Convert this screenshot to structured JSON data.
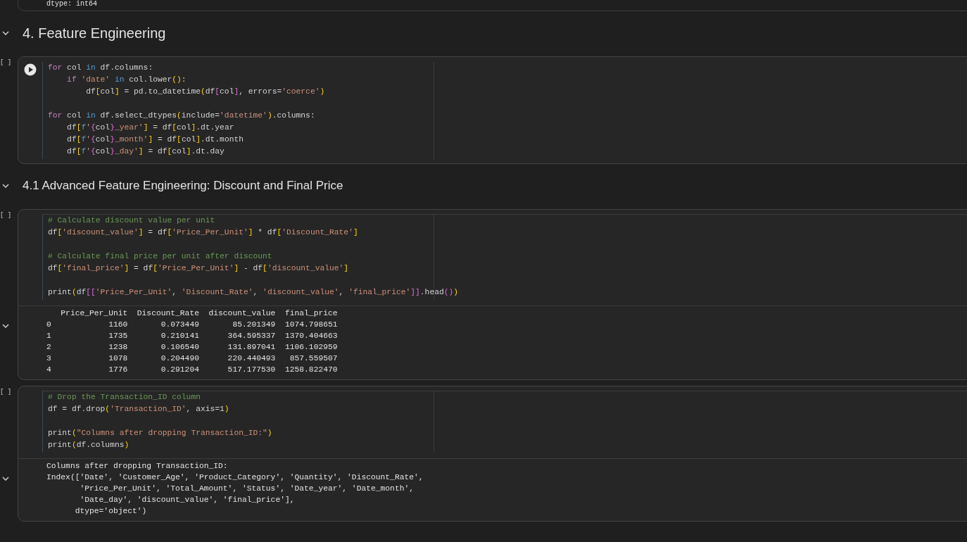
{
  "top_output": {
    "lines": [
      "dtype: int64"
    ]
  },
  "cells": [
    {
      "kind": "heading",
      "text": "4. Feature Engineering",
      "expanded": true
    },
    {
      "kind": "code",
      "counter": "[ ]",
      "run_button": true,
      "lines": [
        {
          "kind": "code",
          "tokens": [
            {
              "kind": "kw",
              "text": "for"
            },
            {
              "kind": "p",
              "text": " col "
            },
            {
              "kind": "op",
              "text": "in"
            },
            {
              "kind": "p",
              "text": " df.columns:"
            }
          ]
        },
        {
          "kind": "code",
          "tokens": [
            {
              "kind": "kw",
              "text": "    if"
            },
            {
              "kind": "str",
              "text": " 'date'"
            },
            {
              "kind": "op",
              "text": " in"
            },
            {
              "kind": "p",
              "text": " col.lower"
            },
            {
              "kind": "b1",
              "text": "()"
            },
            {
              "kind": "p",
              "text": ":"
            }
          ]
        },
        {
          "kind": "code",
          "tokens": [
            {
              "kind": "p",
              "text": "        df"
            },
            {
              "kind": "b1",
              "text": "["
            },
            {
              "kind": "p",
              "text": "col"
            },
            {
              "kind": "b1",
              "text": "]"
            },
            {
              "kind": "p",
              "text": " = pd.to_datetime"
            },
            {
              "kind": "b1",
              "text": "("
            },
            {
              "kind": "p",
              "text": "df"
            },
            {
              "kind": "b2",
              "text": "["
            },
            {
              "kind": "p",
              "text": "col"
            },
            {
              "kind": "b2",
              "text": "]"
            },
            {
              "kind": "p",
              "text": ", errors="
            },
            {
              "kind": "str",
              "text": "'coerce'"
            },
            {
              "kind": "b1",
              "text": ")"
            }
          ]
        },
        {
          "kind": "blank"
        },
        {
          "kind": "code",
          "tokens": [
            {
              "kind": "kw",
              "text": "for"
            },
            {
              "kind": "p",
              "text": " col "
            },
            {
              "kind": "op",
              "text": "in"
            },
            {
              "kind": "p",
              "text": " df.select_dtypes"
            },
            {
              "kind": "b1",
              "text": "("
            },
            {
              "kind": "p",
              "text": "include="
            },
            {
              "kind": "str",
              "text": "'datetime'"
            },
            {
              "kind": "b1",
              "text": ")"
            },
            {
              "kind": "p",
              "text": ".columns:"
            }
          ]
        },
        {
          "kind": "code",
          "tokens": [
            {
              "kind": "p",
              "text": "    df"
            },
            {
              "kind": "b1",
              "text": "["
            },
            {
              "kind": "op",
              "text": "f"
            },
            {
              "kind": "str",
              "text": "'"
            },
            {
              "kind": "b2",
              "text": "{"
            },
            {
              "kind": "p",
              "text": "col"
            },
            {
              "kind": "b2",
              "text": "}"
            },
            {
              "kind": "str",
              "text": "_year'"
            },
            {
              "kind": "b1",
              "text": "]"
            },
            {
              "kind": "p",
              "text": " = df"
            },
            {
              "kind": "b1",
              "text": "["
            },
            {
              "kind": "p",
              "text": "col"
            },
            {
              "kind": "b1",
              "text": "]"
            },
            {
              "kind": "p",
              "text": ".dt.year"
            }
          ]
        },
        {
          "kind": "code",
          "tokens": [
            {
              "kind": "p",
              "text": "    df"
            },
            {
              "kind": "b1",
              "text": "["
            },
            {
              "kind": "op",
              "text": "f"
            },
            {
              "kind": "str",
              "text": "'"
            },
            {
              "kind": "b2",
              "text": "{"
            },
            {
              "kind": "p",
              "text": "col"
            },
            {
              "kind": "b2",
              "text": "}"
            },
            {
              "kind": "str",
              "text": "_month'"
            },
            {
              "kind": "b1",
              "text": "]"
            },
            {
              "kind": "p",
              "text": " = df"
            },
            {
              "kind": "b1",
              "text": "["
            },
            {
              "kind": "p",
              "text": "col"
            },
            {
              "kind": "b1",
              "text": "]"
            },
            {
              "kind": "p",
              "text": ".dt.month"
            }
          ]
        },
        {
          "kind": "code",
          "tokens": [
            {
              "kind": "p",
              "text": "    df"
            },
            {
              "kind": "b1",
              "text": "["
            },
            {
              "kind": "op",
              "text": "f"
            },
            {
              "kind": "str",
              "text": "'"
            },
            {
              "kind": "b2",
              "text": "{"
            },
            {
              "kind": "p",
              "text": "col"
            },
            {
              "kind": "b2",
              "text": "}"
            },
            {
              "kind": "str",
              "text": "_day'"
            },
            {
              "kind": "b1",
              "text": "]"
            },
            {
              "kind": "p",
              "text": " = df"
            },
            {
              "kind": "b1",
              "text": "["
            },
            {
              "kind": "p",
              "text": "col"
            },
            {
              "kind": "b1",
              "text": "]"
            },
            {
              "kind": "p",
              "text": ".dt.day"
            }
          ]
        }
      ]
    },
    {
      "kind": "subheading",
      "text": "4.1 Advanced Feature Engineering: Discount and Final Price",
      "expanded": true
    },
    {
      "kind": "code",
      "counter": "[ ]",
      "run_button": false,
      "lines": [
        {
          "kind": "code",
          "tokens": [
            {
              "kind": "cm",
              "text": "# Calculate discount value per unit"
            }
          ]
        },
        {
          "kind": "code",
          "tokens": [
            {
              "kind": "p",
              "text": "df"
            },
            {
              "kind": "b1",
              "text": "["
            },
            {
              "kind": "str",
              "text": "'discount_value'"
            },
            {
              "kind": "b1",
              "text": "]"
            },
            {
              "kind": "p",
              "text": " = df"
            },
            {
              "kind": "b1",
              "text": "["
            },
            {
              "kind": "str",
              "text": "'Price_Per_Unit'"
            },
            {
              "kind": "b1",
              "text": "]"
            },
            {
              "kind": "p",
              "text": " * df"
            },
            {
              "kind": "b1",
              "text": "["
            },
            {
              "kind": "str",
              "text": "'Discount_Rate'"
            },
            {
              "kind": "b1",
              "text": "]"
            }
          ]
        },
        {
          "kind": "blank"
        },
        {
          "kind": "code",
          "tokens": [
            {
              "kind": "cm",
              "text": "# Calculate final price per unit after discount"
            }
          ]
        },
        {
          "kind": "code",
          "tokens": [
            {
              "kind": "p",
              "text": "df"
            },
            {
              "kind": "b1",
              "text": "["
            },
            {
              "kind": "str",
              "text": "'final_price'"
            },
            {
              "kind": "b1",
              "text": "]"
            },
            {
              "kind": "p",
              "text": " = df"
            },
            {
              "kind": "b1",
              "text": "["
            },
            {
              "kind": "str",
              "text": "'Price_Per_Unit'"
            },
            {
              "kind": "b1",
              "text": "]"
            },
            {
              "kind": "p",
              "text": " - df"
            },
            {
              "kind": "b1",
              "text": "["
            },
            {
              "kind": "str",
              "text": "'discount_value'"
            },
            {
              "kind": "b1",
              "text": "]"
            }
          ]
        },
        {
          "kind": "blank"
        },
        {
          "kind": "code",
          "tokens": [
            {
              "kind": "p",
              "text": "print"
            },
            {
              "kind": "b1",
              "text": "("
            },
            {
              "kind": "p",
              "text": "df"
            },
            {
              "kind": "b2",
              "text": "[["
            },
            {
              "kind": "str",
              "text": "'Price_Per_Unit'"
            },
            {
              "kind": "p",
              "text": ", "
            },
            {
              "kind": "str",
              "text": "'Discount_Rate'"
            },
            {
              "kind": "p",
              "text": ", "
            },
            {
              "kind": "str",
              "text": "'discount_value'"
            },
            {
              "kind": "p",
              "text": ", "
            },
            {
              "kind": "str",
              "text": "'final_price'"
            },
            {
              "kind": "b2",
              "text": "]]"
            },
            {
              "kind": "p",
              "text": ".head"
            },
            {
              "kind": "b2",
              "text": "()"
            },
            {
              "kind": "b1",
              "text": ")"
            }
          ]
        }
      ],
      "output": {
        "expanded": true,
        "lines": [
          "   Price_Per_Unit  Discount_Rate  discount_value  final_price",
          "0            1160       0.073449       85.201349  1074.798651",
          "1            1735       0.210141      364.595337  1370.404663",
          "2            1238       0.106540      131.897041  1106.102959",
          "3            1078       0.204490      220.440493   857.559507",
          "4            1776       0.291204      517.177530  1258.822470"
        ]
      }
    },
    {
      "kind": "code",
      "counter": "[ ]",
      "run_button": false,
      "lines": [
        {
          "kind": "code",
          "tokens": [
            {
              "kind": "cm",
              "text": "# Drop the Transaction_ID column"
            }
          ]
        },
        {
          "kind": "code",
          "tokens": [
            {
              "kind": "p",
              "text": "df = df.drop"
            },
            {
              "kind": "b1",
              "text": "("
            },
            {
              "kind": "str",
              "text": "'Transaction_ID'"
            },
            {
              "kind": "p",
              "text": ", axis=1"
            },
            {
              "kind": "b1",
              "text": ")"
            }
          ]
        },
        {
          "kind": "blank"
        },
        {
          "kind": "code",
          "tokens": [
            {
              "kind": "p",
              "text": "print"
            },
            {
              "kind": "b1",
              "text": "("
            },
            {
              "kind": "str",
              "text": "\"Columns after dropping Transaction_ID:\""
            },
            {
              "kind": "b1",
              "text": ")"
            }
          ]
        },
        {
          "kind": "code",
          "tokens": [
            {
              "kind": "p",
              "text": "print"
            },
            {
              "kind": "b1",
              "text": "("
            },
            {
              "kind": "p",
              "text": "df.columns"
            },
            {
              "kind": "b1",
              "text": ")"
            }
          ]
        }
      ],
      "output": {
        "expanded": true,
        "lines": [
          "Columns after dropping Transaction_ID:",
          "Index(['Date', 'Customer_Age', 'Product_Category', 'Quantity', 'Discount_Rate',",
          "       'Price_Per_Unit', 'Total_Amount', 'Status', 'Date_year', 'Date_month',",
          "       'Date_day', 'discount_value', 'final_price'],",
          "      dtype='object')"
        ]
      }
    }
  ]
}
